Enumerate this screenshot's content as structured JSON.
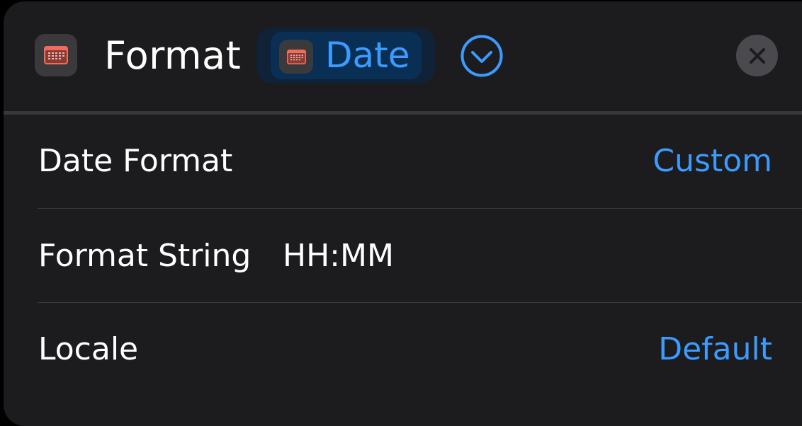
{
  "header": {
    "title": "Format",
    "icon": "calendar-icon",
    "token": {
      "label": "Date",
      "icon": "calendar-icon"
    },
    "expand_icon": "chevron-down-circle-icon",
    "close_icon": "close-icon"
  },
  "rows": [
    {
      "label": "Date Format",
      "value": "Custom"
    },
    {
      "label": "Format String",
      "value": "HH:MM"
    },
    {
      "label": "Locale",
      "value": "Default"
    }
  ],
  "colors": {
    "background": "#1c1c1e",
    "accent": "#3b9bff",
    "calendar_red": "#f26b5b",
    "text": "#ffffff"
  }
}
